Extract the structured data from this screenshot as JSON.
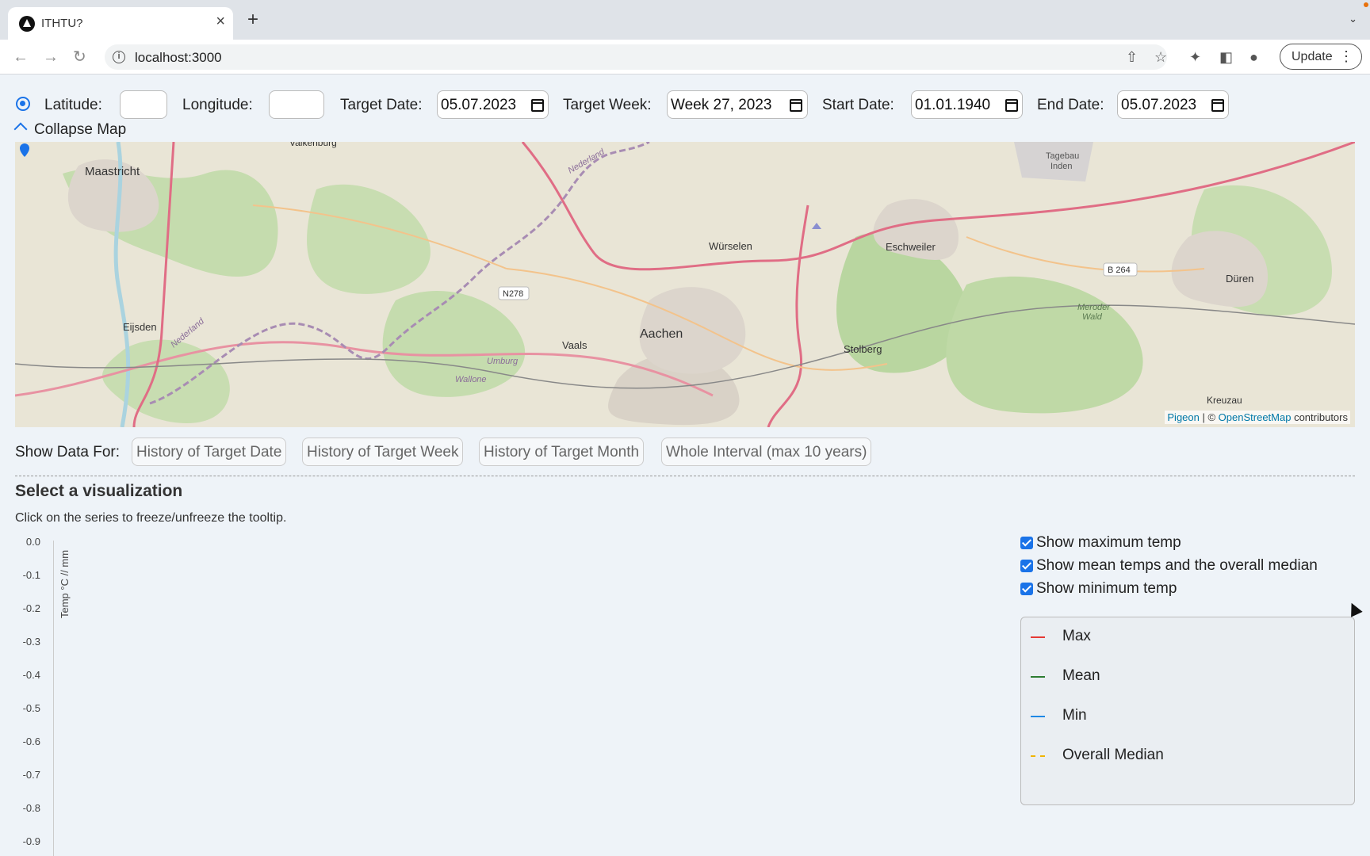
{
  "browser": {
    "tab_title": "ITHTU?",
    "url": "localhost:3000",
    "update_label": "Update"
  },
  "controls": {
    "latitude_label": "Latitude:",
    "latitude_value": "",
    "longitude_label": "Longitude:",
    "longitude_value": "",
    "target_date_label": "Target Date:",
    "target_date_value": "05.07.2023",
    "target_week_label": "Target Week:",
    "target_week_value": "Week 27, 2023",
    "start_date_label": "Start Date:",
    "start_date_value": "01.01.1940",
    "end_date_label": "End Date:",
    "end_date_value": "05.07.2023"
  },
  "map": {
    "collapse_label": "Collapse Map",
    "places": [
      "Valkenburg",
      "Maastricht",
      "Eijsden",
      "Vaals",
      "Aachen",
      "Würselen",
      "Eschweiler",
      "Stolberg",
      "Düren",
      "Kreuzau",
      "Tagebau Inden",
      "Meroder Wald",
      "Wallone",
      "Umburg",
      "Nederland"
    ],
    "road_labels": [
      "N278",
      "B 264"
    ],
    "attribution_link1": "Pigeon",
    "attribution_sep": " | © ",
    "attribution_link2": "OpenStreetMap",
    "attribution_tail": " contributors"
  },
  "show_data": {
    "label": "Show Data For:",
    "options": [
      "History of Target Date",
      "History of Target Week",
      "History of Target Month",
      "Whole Interval (max 10 years)"
    ]
  },
  "visualization": {
    "title": "Select a visualization",
    "hint": "Click on the series to freeze/unfreeze the tooltip.",
    "y_axis_label": "Temp °C // mm",
    "y_ticks": [
      "0.0",
      "-0.1",
      "-0.2",
      "-0.3",
      "-0.4",
      "-0.5",
      "-0.6",
      "-0.7",
      "-0.8",
      "-0.9"
    ]
  },
  "toggles": [
    {
      "label": "Show maximum temp",
      "checked": true
    },
    {
      "label": "Show mean temps and the overall median",
      "checked": true
    },
    {
      "label": "Show minimum temp",
      "checked": true
    }
  ],
  "legend": [
    {
      "label": "Max",
      "color": "#e53935"
    },
    {
      "label": "Mean",
      "color": "#2e7d32"
    },
    {
      "label": "Min",
      "color": "#1e88e5"
    },
    {
      "label": "Overall Median",
      "color": "#f0b400"
    }
  ]
}
